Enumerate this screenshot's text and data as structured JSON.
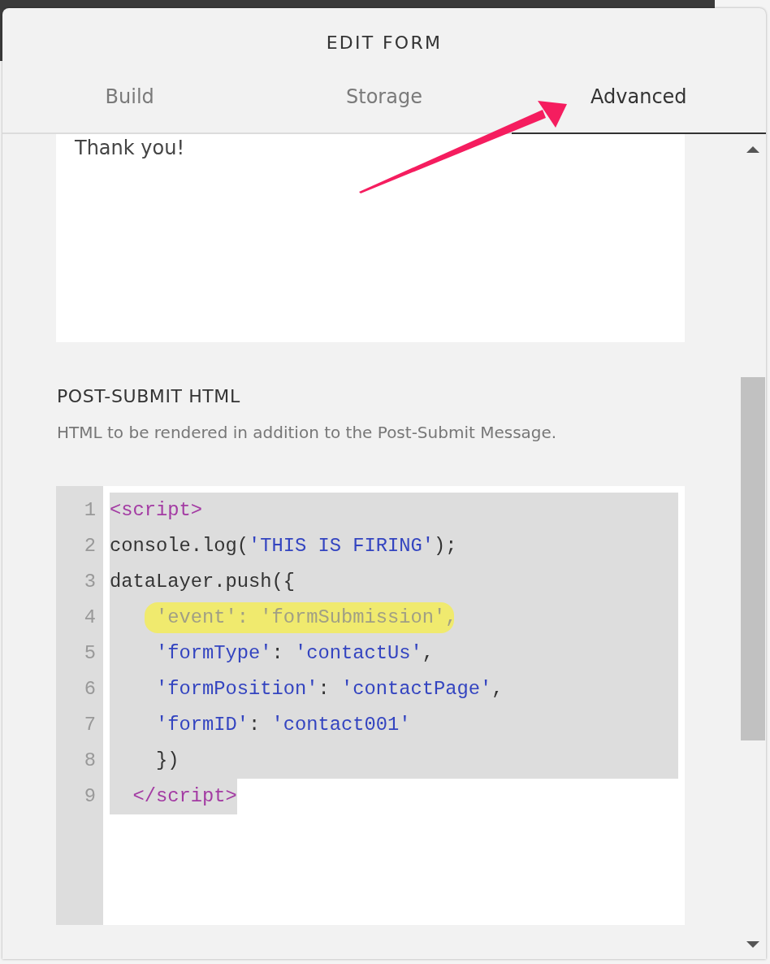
{
  "dialog": {
    "title": "EDIT FORM"
  },
  "tabs": [
    {
      "label": "Build",
      "selected": false
    },
    {
      "label": "Storage",
      "selected": false
    },
    {
      "label": "Advanced",
      "selected": true
    }
  ],
  "message_field": {
    "value": "Thank you!"
  },
  "post_submit_html": {
    "heading": "POST-SUBMIT HTML",
    "description": "HTML to be rendered in addition to the Post-Submit Message.",
    "code_lines": [
      {
        "number": "1",
        "selected": true,
        "highlighted": false,
        "tokens": [
          {
            "kind": "tag",
            "text": "<script>"
          }
        ]
      },
      {
        "number": "2",
        "selected": true,
        "highlighted": false,
        "tokens": [
          {
            "kind": "plain",
            "text": "console.log("
          },
          {
            "kind": "string",
            "text": "'THIS IS FIRING'"
          },
          {
            "kind": "plain",
            "text": ");"
          }
        ]
      },
      {
        "number": "3",
        "selected": true,
        "highlighted": false,
        "tokens": [
          {
            "kind": "plain",
            "text": "dataLayer.push({"
          }
        ]
      },
      {
        "number": "4",
        "selected": true,
        "highlighted": true,
        "tokens": [
          {
            "kind": "string",
            "text": "    'event'"
          },
          {
            "kind": "plain",
            "text": ": "
          },
          {
            "kind": "string",
            "text": "'formSubmission'"
          },
          {
            "kind": "plain",
            "text": ","
          }
        ]
      },
      {
        "number": "5",
        "selected": true,
        "highlighted": false,
        "tokens": [
          {
            "kind": "string",
            "text": "    'formType'"
          },
          {
            "kind": "plain",
            "text": ": "
          },
          {
            "kind": "string",
            "text": "'contactUs'"
          },
          {
            "kind": "plain",
            "text": ","
          }
        ]
      },
      {
        "number": "6",
        "selected": true,
        "highlighted": false,
        "tokens": [
          {
            "kind": "string",
            "text": "    'formPosition'"
          },
          {
            "kind": "plain",
            "text": ": "
          },
          {
            "kind": "string",
            "text": "'contactPage'"
          },
          {
            "kind": "plain",
            "text": ","
          }
        ]
      },
      {
        "number": "7",
        "selected": true,
        "highlighted": false,
        "tokens": [
          {
            "kind": "string",
            "text": "    'formID'"
          },
          {
            "kind": "plain",
            "text": ": "
          },
          {
            "kind": "string",
            "text": "'contact001'"
          }
        ]
      },
      {
        "number": "8",
        "selected": true,
        "highlighted": false,
        "tokens": [
          {
            "kind": "plain",
            "text": "    })"
          }
        ]
      },
      {
        "number": "9",
        "selected": true,
        "highlighted": false,
        "tokens": [
          {
            "kind": "tag",
            "text": "  </script>"
          }
        ]
      }
    ]
  }
}
